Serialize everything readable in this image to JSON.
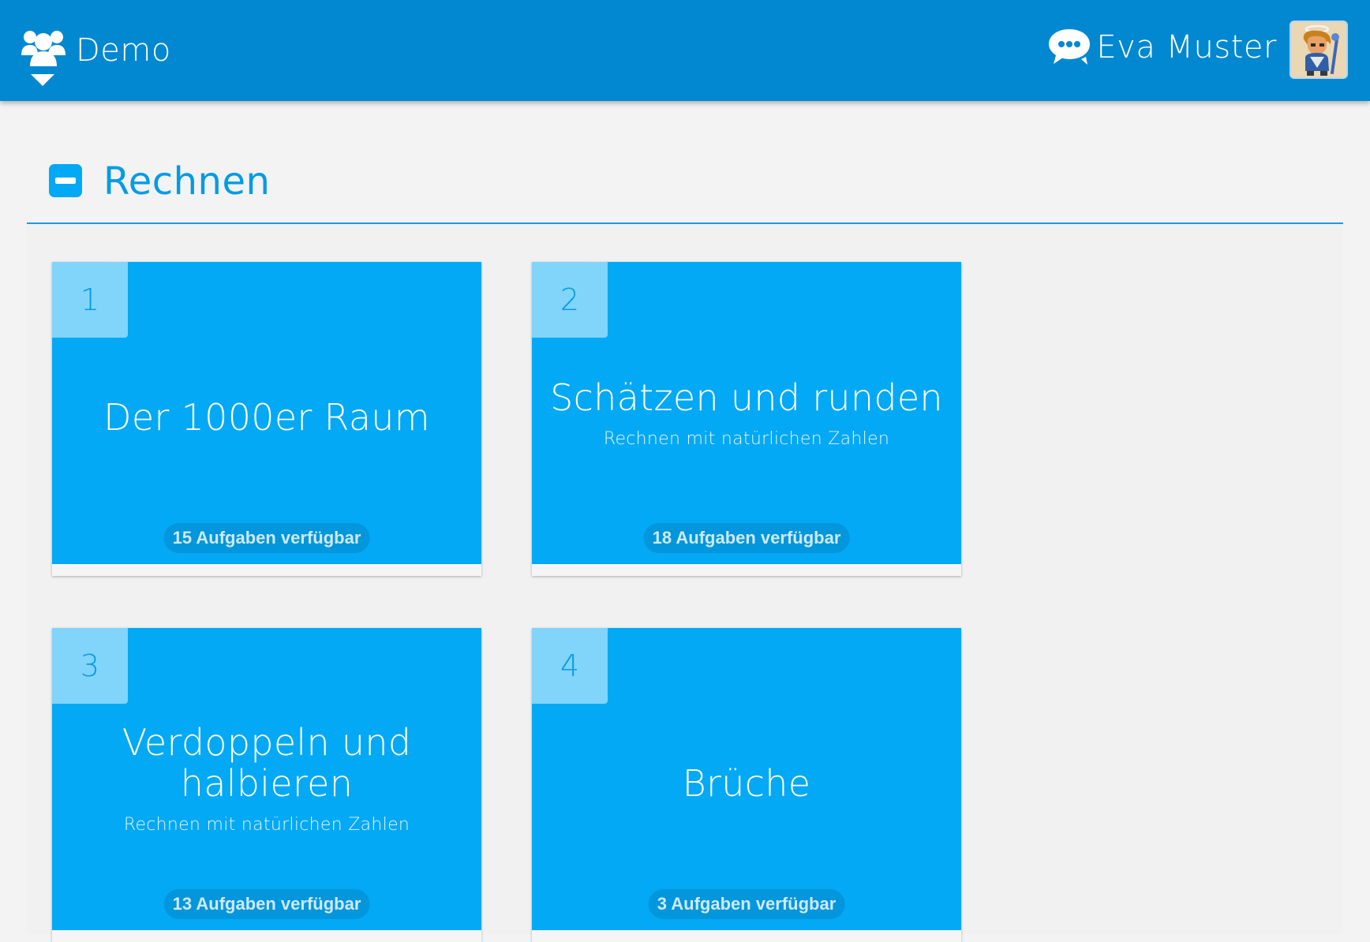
{
  "header": {
    "group_name": "Demo",
    "user_name": "Eva Muster",
    "icons": {
      "group": "users-icon",
      "group_dropdown": "caret-down-icon",
      "chat": "chat-bubble-icon",
      "avatar": "avatar-character-image"
    }
  },
  "section": {
    "title": "Rechnen",
    "toggle_icon": "minus-square-icon"
  },
  "cards": [
    {
      "number": "1",
      "title": "Der 1000er Raum",
      "subtitle": "",
      "tasks": "15 Aufgaben verfügbar"
    },
    {
      "number": "2",
      "title": "Schätzen und runden",
      "subtitle": "Rechnen mit natürlichen Zahlen",
      "tasks": "18 Aufgaben verfügbar"
    },
    {
      "number": "3",
      "title_lines": [
        "Verdoppeln und",
        "halbieren"
      ],
      "subtitle": "Rechnen mit natürlichen Zahlen",
      "tasks": "13 Aufgaben verfügbar"
    },
    {
      "number": "4",
      "title": "Brüche",
      "subtitle": "",
      "tasks": "3 Aufgaben verfügbar"
    }
  ],
  "colors": {
    "header_bg": "#0288d1",
    "accent": "#03a9f4",
    "number_tab": "#81d4fa",
    "badge_bg": "#0296dc",
    "page_bg": "#f3f3f3"
  }
}
